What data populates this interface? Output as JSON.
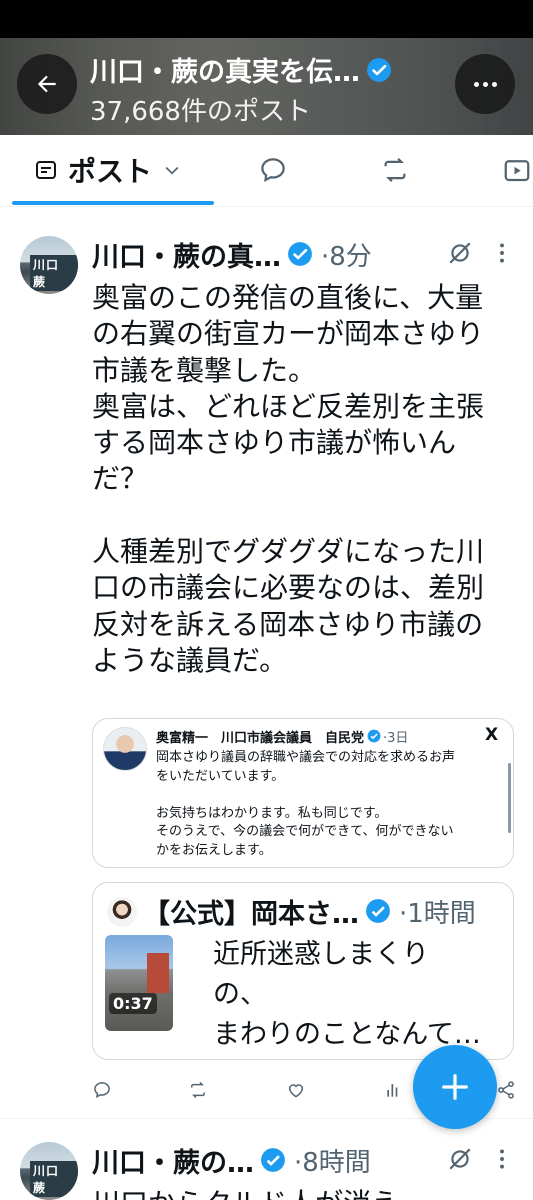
{
  "header": {
    "title": "川口・蕨の真実を伝…",
    "post_count": "37,668件のポスト",
    "back_icon": "arrow-left-icon",
    "more_icon": "more-horizontal-icon"
  },
  "tabs": {
    "posts_label": "ポスト",
    "active_color": "#1d9bf0"
  },
  "tweet": {
    "author": "川口・蕨の真…",
    "avatar_text": "川口 蕨",
    "time": "·8分",
    "body_lines": [
      "奥富のこの発信の直後に、大量",
      "の右翼の街宣カーが岡本さゆり",
      "市議を襲撃した。",
      "奥富は、どれほど反差別を主張",
      "する岡本さゆり市議が怖いん",
      "だ？",
      "",
      "人種差別でグダグダになった川",
      "口の市議会に必要なのは、差別",
      "反対を訴える岡本さゆり市議の",
      "ような議員だ。"
    ],
    "quote1": {
      "author": "奥富精一　川口市議会議員　自民党",
      "time": "·3日",
      "source_mark": "X",
      "lines": [
        "岡本さゆり議員の辞職や議会での対応を求めるお声",
        "をいただいています。",
        "",
        "お気持ちはわかります。私も同じです。",
        "そのうえで、今の議会で何ができて、何ができない",
        "かをお伝えします。"
      ]
    },
    "quote2": {
      "author": "【公式】岡本さ…",
      "time": "·1時間",
      "video_duration": "0:37",
      "lines": [
        "近所迷惑しまくり",
        "の、",
        "まわりのことなんて…"
      ]
    }
  },
  "tweet2": {
    "author": "川口・蕨の…",
    "time": "·8時間",
    "body": "川口からクルド人が消え"
  },
  "colors": {
    "verified": "#1d9bf0",
    "secondary_text": "#536471",
    "fab": "#1d9bf0"
  }
}
